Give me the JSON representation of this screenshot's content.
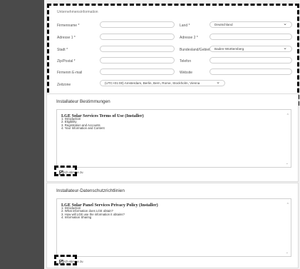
{
  "company": {
    "section_title": "Unternehmensinformation",
    "fields": {
      "company_name": {
        "label": "Firmenname *",
        "value": ""
      },
      "address1": {
        "label": "Adresse 1 *",
        "value": ""
      },
      "city": {
        "label": "Stadt *",
        "value": ""
      },
      "zip": {
        "label": "Zip/Postal *",
        "value": ""
      },
      "company_email": {
        "label": "Firmenm E-mail",
        "value": ""
      },
      "country": {
        "label": "Land *",
        "value": "Deutschland"
      },
      "address2": {
        "label": "Adresse 2 *",
        "value": ""
      },
      "state": {
        "label": "Bundesland/Gebiet *",
        "value": "Baden-Württemberg"
      },
      "phone": {
        "label": "Telefon",
        "value": ""
      },
      "website": {
        "label": "Website",
        "value": ""
      },
      "timezone": {
        "label": "Zeitzone",
        "value": "(UTC+01:00) Amsterdam, Berlin, Bern, Rome, Stockholm, Vienna"
      }
    }
  },
  "terms_section": {
    "title": "Installateur Bestimmungen",
    "doc_title": "LGE Solar Services Terms of Use (Installer)",
    "items": [
      "1. Introduction",
      "2. Eligibility",
      "3. Registration and Accounts",
      "4. Your Information and Content"
    ],
    "agree_label": "Ich stimme zu",
    "agree_checked": true
  },
  "privacy_section": {
    "title": "Installateur-Datenschutzrichtlinien",
    "doc_title": "LGE Solar Panel Services Privacy Policy (Installer)",
    "items": [
      "1. Introduction",
      "2. What information does LGE obtain?",
      "3. How will LGE use the information it obtains?",
      "4. Information Sharing"
    ],
    "agree_label": "Ich stimme zu",
    "agree_checked": true
  },
  "icons": {
    "chevron": "chevron-down-icon",
    "scroll_up": "scroll-up-icon",
    "scroll_down": "scroll-down-icon",
    "check": "check-icon"
  }
}
